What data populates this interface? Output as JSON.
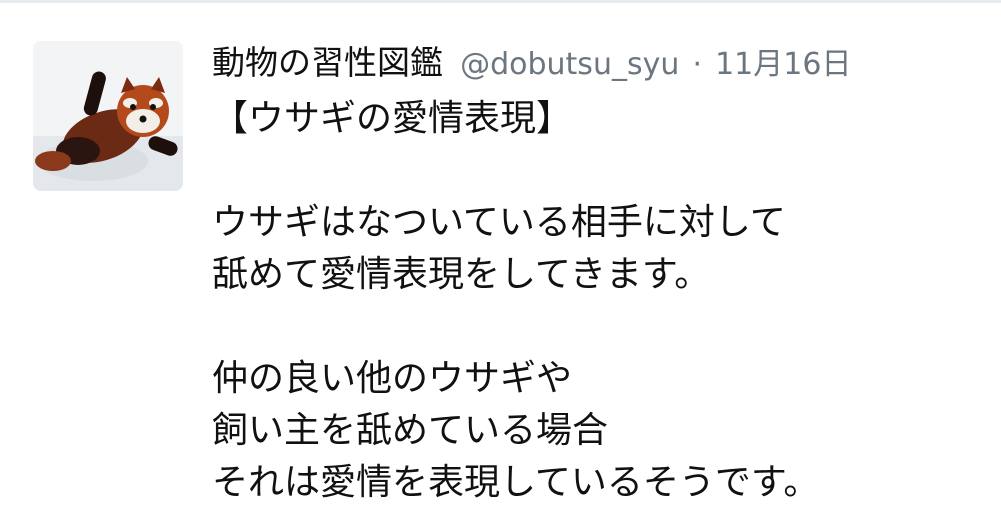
{
  "tweet": {
    "display_name": "動物の習性図鑑",
    "handle": "@dobutsu_syu",
    "separator": "·",
    "timestamp": "11月16日",
    "headline": "【ウサギの愛情表現】",
    "paragraph1": [
      "ウサギはなついている相手に対して",
      "舐めて愛情表現をしてきます。"
    ],
    "paragraph2": [
      "仲の良い他のウサギや",
      "飼い主を舐めている場合",
      "それは愛情を表現しているそうです。"
    ]
  },
  "colors": {
    "text": "#111111",
    "secondary": "#6b7680",
    "divider": "#e6ecf0"
  }
}
